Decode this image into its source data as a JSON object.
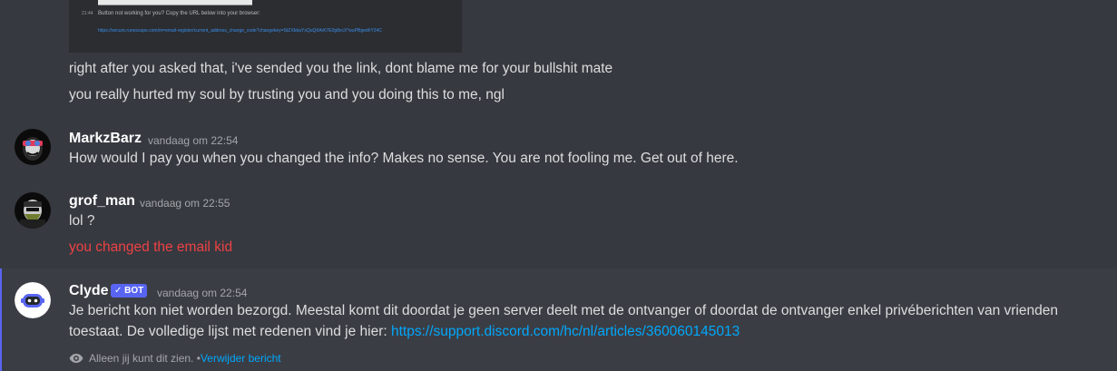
{
  "embed": {
    "timestamp": "21:44",
    "text": "Button not working for you? Copy the URL below into your browser:",
    "url": "https://secure.runescape.com/m=email-register/current_address_change_code?changekey=StZXbbaYsQuQtIArK7E0g8vcX*wuPBgedhY34C"
  },
  "prev_lines": [
    "right after you asked that, i've sended you the link, dont blame me for your bullshit mate",
    "you really hurted my soul by trusting you and you doing this to me, ngl"
  ],
  "messages": [
    {
      "username": "MarkzBarz",
      "timestamp": "vandaag om 22:54",
      "lines": [
        "How would I pay you when you changed the info? Makes no sense. You are not fooling me. Get out of here."
      ]
    },
    {
      "username": "grof_man",
      "timestamp": "vandaag om 22:55",
      "lines": [
        "lol ?"
      ],
      "red_line": "you changed the email kid"
    },
    {
      "username": "Clyde",
      "badge": "✓ BOT",
      "timestamp": "vandaag om 22:54",
      "line1": "Je bericht kon niet worden bezorgd. Meestal komt dit doordat je geen server deelt met de ontvanger of doordat de ontvanger enkel privéberichten van vrienden",
      "line2_text": "toestaat. De volledige lijst met redenen vind je hier: ",
      "line2_link": "https://support.discord.com/hc/nl/articles/360060145013"
    }
  ],
  "ephemeral": {
    "text": "Alleen jij kunt dit zien. • ",
    "link": "Verwijder bericht"
  },
  "colors": {
    "background": "#36393f",
    "text": "#dcddde",
    "username": "#ffffff",
    "timestamp": "#a3a6aa",
    "red": "#ed4245",
    "link": "#00a8fc",
    "bot_badge": "#5865f2"
  }
}
